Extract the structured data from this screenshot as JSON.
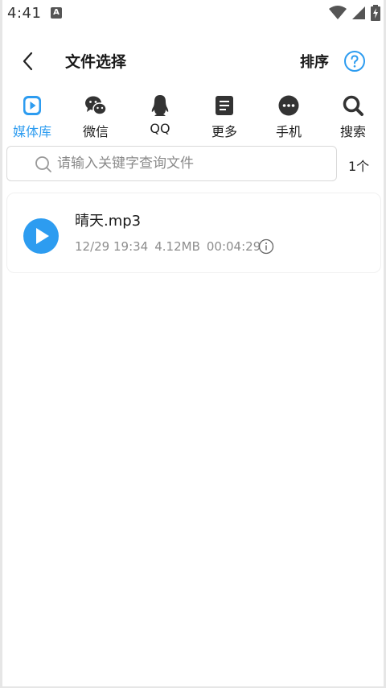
{
  "status": {
    "time": "4:41",
    "a_badge": "A"
  },
  "appbar": {
    "title": "文件选择",
    "sort_label": "排序"
  },
  "tabs": [
    {
      "label": "媒体库",
      "icon": "media-library-icon",
      "active": true
    },
    {
      "label": "微信",
      "icon": "wechat-icon",
      "active": false
    },
    {
      "label": "QQ",
      "icon": "qq-penguin-icon",
      "active": false
    },
    {
      "label": "更多",
      "icon": "more-doc-icon",
      "active": false
    },
    {
      "label": "手机",
      "icon": "phone-dots-icon",
      "active": false
    },
    {
      "label": "搜索",
      "icon": "search-icon",
      "active": false
    }
  ],
  "search": {
    "placeholder": "请输入关键字查询文件",
    "value": "",
    "count": "1个"
  },
  "files": [
    {
      "name": "晴天.mp3",
      "date": "12/29 19:34",
      "size": "4.12MB",
      "duration": "00:04:29"
    }
  ],
  "colors": {
    "accent": "#2d9cf0",
    "text": "#1a1a1a",
    "muted": "#8d8d8d"
  }
}
